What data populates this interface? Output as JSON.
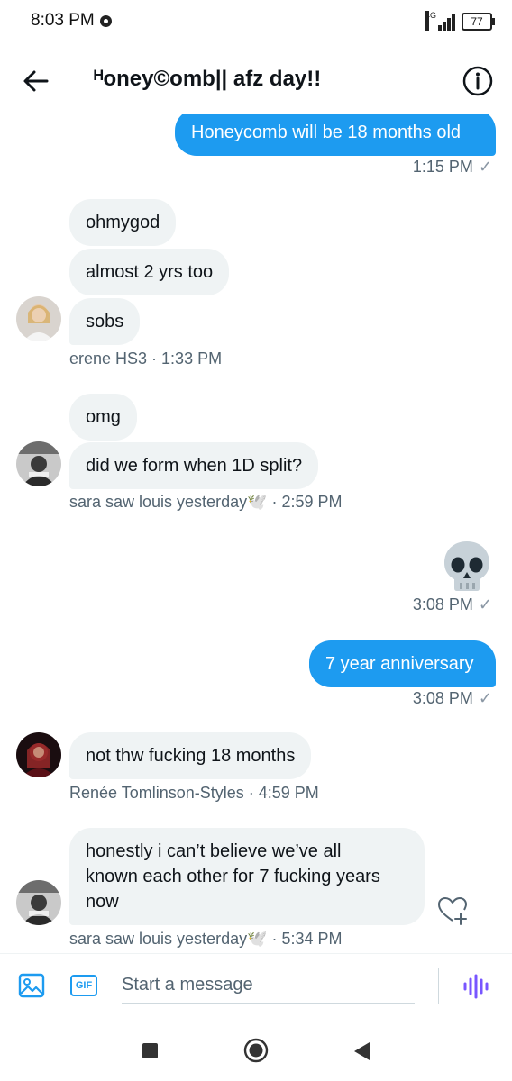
{
  "status_bar": {
    "time": "8:03 PM",
    "network": "4G",
    "battery": "77"
  },
  "header": {
    "title": "ᴴoney©omb|| afz day!!"
  },
  "messages": [
    {
      "text": "Honeycomb will be 18 months old"
    },
    {
      "meta": "1:15 PM"
    },
    {
      "text": "ohmygod"
    },
    {
      "text": "almost 2 yrs too"
    },
    {
      "text": "sobs"
    },
    {
      "meta": "erene HS3 · 1:33 PM"
    },
    {
      "text": "omg"
    },
    {
      "text": "did we form when 1D split?"
    },
    {
      "meta": "sara saw louis yesterday🕊️ · 2:59 PM"
    },
    {
      "emoji": "skull"
    },
    {
      "meta": "3:08 PM"
    },
    {
      "text": "7 year anniversary"
    },
    {
      "meta": "3:08 PM"
    },
    {
      "text": "not thw fucking 18 months"
    },
    {
      "meta": "Renée Tomlinson-Styles · 4:59 PM"
    },
    {
      "line1": "honestly i can’t believe we’ve all",
      "line2": "known each other for 7 fucking years",
      "line3": "now"
    },
    {
      "meta": "sara saw louis yesterday🕊️ · 5:34 PM"
    }
  ],
  "check_mark": "✓",
  "composer": {
    "placeholder": "Start a message",
    "gif_label": "GIF"
  },
  "colors": {
    "accent": "#1d9bf0",
    "incoming_bubble": "#eff3f4",
    "meta_text": "#536471"
  },
  "icons": {
    "back": "arrow-left-icon",
    "info": "info-icon",
    "media": "image-icon",
    "gif": "gif-icon",
    "voice": "voice-wave-icon",
    "react": "heart-plus-icon"
  }
}
